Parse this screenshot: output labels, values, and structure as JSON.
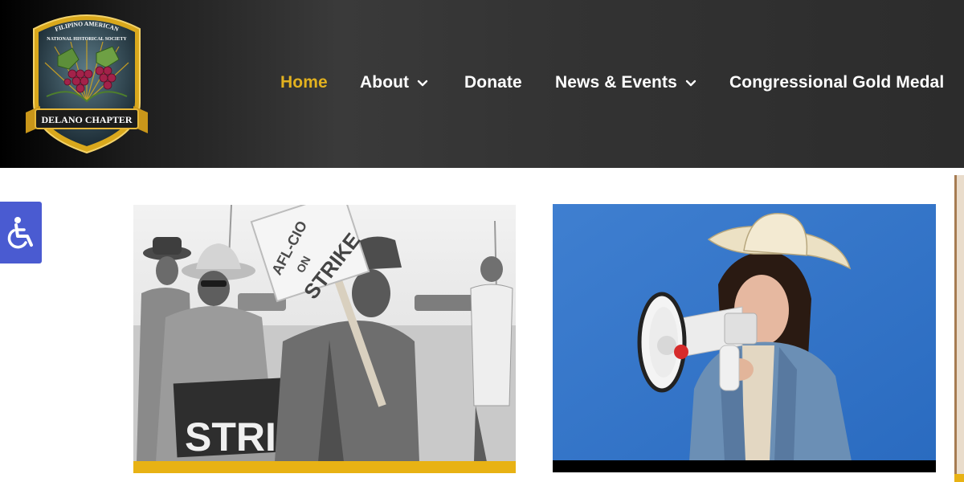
{
  "logo": {
    "arc_line1": "FILIPINO AMERICAN",
    "arc_line2": "NATIONAL HISTORICAL SOCIETY",
    "banner": "DELANO CHAPTER"
  },
  "nav": {
    "items": [
      {
        "label": "Home",
        "active": true
      },
      {
        "label": "About",
        "has_dropdown": true
      },
      {
        "label": "Donate"
      },
      {
        "label": "News & Events",
        "has_dropdown": true
      },
      {
        "label": "Congressional Gold Medal"
      }
    ]
  },
  "accessibility": {
    "icon": "wheelchair-icon"
  },
  "cards": [
    {
      "sign_top_line1": "AFL-CIO",
      "sign_top_line2": "ON",
      "sign_top_line3": "STRIKE",
      "sign_bottom": "STRIK",
      "accent_color": "#e8b214"
    },
    {
      "accent_color": "#000000"
    }
  ],
  "colors": {
    "header_bg": "#2c2c2c",
    "nav_active": "#e2b11f",
    "accessibility_bg": "#4a5bd1"
  }
}
